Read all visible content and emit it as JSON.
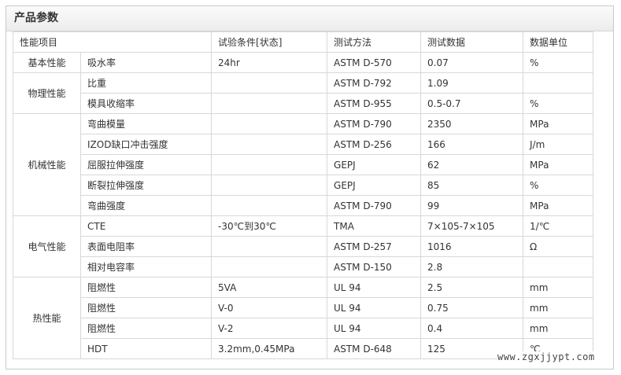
{
  "panel": {
    "title": "产品参数"
  },
  "table": {
    "headers": [
      "性能项目",
      "试验条件[状态]",
      "测试方法",
      "测试数据",
      "数据单位"
    ],
    "groups": [
      {
        "category": "基本性能",
        "rows": [
          {
            "item": "吸水率",
            "condition": "24hr",
            "method": "ASTM D-570",
            "value": "0.07",
            "unit": "%"
          }
        ]
      },
      {
        "category": "物理性能",
        "rows": [
          {
            "item": "比重",
            "condition": "",
            "method": "ASTM D-792",
            "value": "1.09",
            "unit": ""
          },
          {
            "item": "模具收缩率",
            "condition": "",
            "method": "ASTM D-955",
            "value": "0.5-0.7",
            "unit": "%"
          }
        ]
      },
      {
        "category": "机械性能",
        "rows": [
          {
            "item": "弯曲模量",
            "condition": "",
            "method": "ASTM D-790",
            "value": "2350",
            "unit": "MPa"
          },
          {
            "item": "IZOD缺口冲击强度",
            "condition": "",
            "method": "ASTM D-256",
            "value": "166",
            "unit": "J/m"
          },
          {
            "item": "屈服拉伸强度",
            "condition": "",
            "method": "GEPJ",
            "value": "62",
            "unit": "MPa"
          },
          {
            "item": "断裂拉伸强度",
            "condition": "",
            "method": "GEPJ",
            "value": "85",
            "unit": "%"
          },
          {
            "item": "弯曲强度",
            "condition": "",
            "method": "ASTM D-790",
            "value": "99",
            "unit": "MPa"
          }
        ]
      },
      {
        "category": "电气性能",
        "rows": [
          {
            "item": "CTE",
            "condition": "-30℃到30℃",
            "method": "TMA",
            "value": "7×105-7×105",
            "unit": "1/℃"
          },
          {
            "item": "表面电阻率",
            "condition": "",
            "method": "ASTM D-257",
            "value": "1016",
            "unit": "Ω"
          },
          {
            "item": "相对电容率",
            "condition": "",
            "method": "ASTM D-150",
            "value": "2.8",
            "unit": ""
          }
        ]
      },
      {
        "category": "热性能",
        "rows": [
          {
            "item": "阻燃性",
            "condition": "5VA",
            "method": "UL 94",
            "value": "2.5",
            "unit": "mm"
          },
          {
            "item": "阻燃性",
            "condition": "V-0",
            "method": "UL 94",
            "value": "0.75",
            "unit": "mm"
          },
          {
            "item": "阻燃性",
            "condition": "V-2",
            "method": "UL 94",
            "value": "0.4",
            "unit": "mm"
          },
          {
            "item": "HDT",
            "condition": "3.2mm,0.45MPa",
            "method": "ASTM D-648",
            "value": "125",
            "unit": "℃"
          }
        ]
      }
    ]
  },
  "watermark": "www.zgxjjypt.com"
}
